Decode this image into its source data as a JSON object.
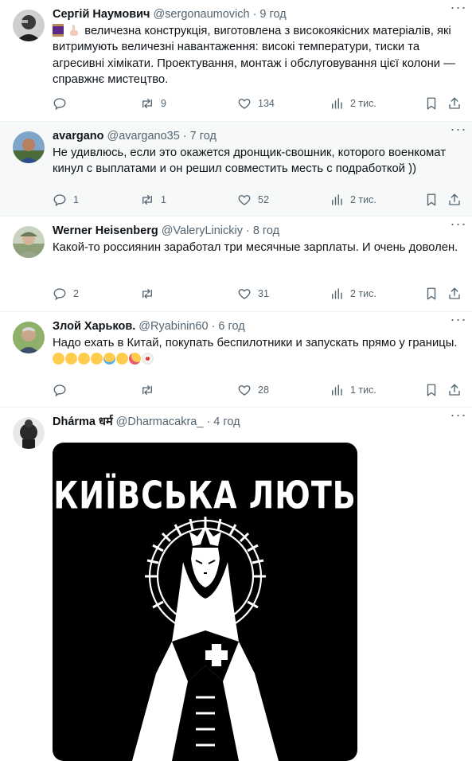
{
  "tweets": [
    {
      "name": "Сергій Наумович",
      "handle": "@sergonaumovich",
      "time": "9 год",
      "text": "величезна конструкція, виготовлена з високоякісних матеріалів, які витримують величезні навантаження: високі температури, тиски та агресивні хімікати. Проектування, монтаж і обслуговування цієї колони — справжнє мистецтво.",
      "replies": "",
      "retweets": "9",
      "likes": "134",
      "views": "2 тис."
    },
    {
      "name": "avargano",
      "handle": "@avargano35",
      "time": "7 год",
      "text": "Не удивлюсь, если это окажется дронщик-свошник, которого военкомат кинул с выплатами и он решил совместить месть с подработкой ))",
      "replies": "1",
      "retweets": "1",
      "likes": "52",
      "views": "2 тис."
    },
    {
      "name": "Werner Heisenberg",
      "handle": "@ValeryLinickiy",
      "time": "8 год",
      "text": "Какой-то россиянин заработал три месячные зарплаты. И очень доволен.",
      "replies": "2",
      "retweets": "",
      "likes": "31",
      "views": "2 тис."
    },
    {
      "name": "Злой Харьков.",
      "handle": "@Ryabinin60",
      "time": "6 год",
      "text": "Надо ехать в Китай, покупать беспилотники и запускать прямо у границы.",
      "replies": "",
      "retweets": "",
      "likes": "28",
      "views": "1 тис."
    },
    {
      "name": "Dhárma धर्म",
      "handle": "@Dharmacakra_",
      "time": "4 год",
      "media_title": "КИЇВСЬКА ЛЮТЬ"
    }
  ],
  "icons": [
    "more-icon",
    "reply-icon",
    "retweet-icon",
    "like-icon",
    "views-icon",
    "bookmark-icon",
    "share-icon"
  ],
  "colors": {
    "text": "#0f1419",
    "secondary": "#536471",
    "divider": "#eff3f4",
    "highlight": "#f7f9f9"
  }
}
